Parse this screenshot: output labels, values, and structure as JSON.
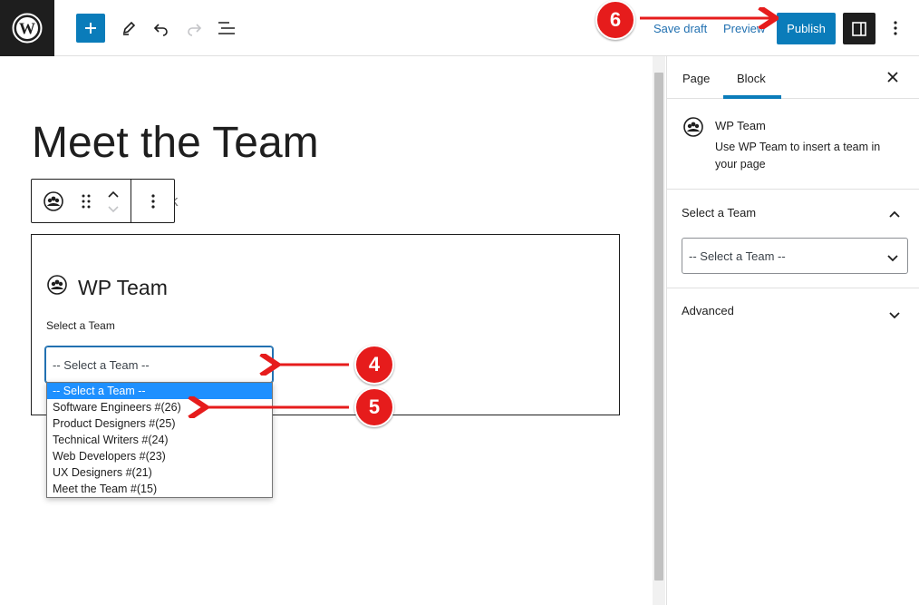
{
  "topbar": {
    "save_draft": "Save draft",
    "preview": "Preview",
    "publish": "Publish"
  },
  "editor": {
    "page_title": "Meet the Team",
    "ghost_text": "ock",
    "block": {
      "heading": "WP Team",
      "select_label": "Select a Team",
      "select_value": "-- Select a Team --",
      "options": [
        "-- Select a Team --",
        "Software Engineers #(26)",
        "Product Designers #(25)",
        "Technical Writers #(24)",
        "Web Developers #(23)",
        "UX Designers #(21)",
        "Meet the Team #(15)"
      ]
    }
  },
  "sidebar": {
    "tabs": [
      "Page",
      "Block"
    ],
    "active_tab": "Block",
    "block_title": "WP Team",
    "block_description": "Use WP Team to insert a team in your page",
    "panel_select_title": "Select a Team",
    "panel_select_value": "-- Select a Team --",
    "panel_advanced_title": "Advanced"
  },
  "annotations": {
    "badge_4": "4",
    "badge_5": "5",
    "badge_6": "6"
  },
  "colors": {
    "accent": "#0a7cba",
    "annotation": "#e61c1c",
    "highlight": "#1e90ff"
  }
}
